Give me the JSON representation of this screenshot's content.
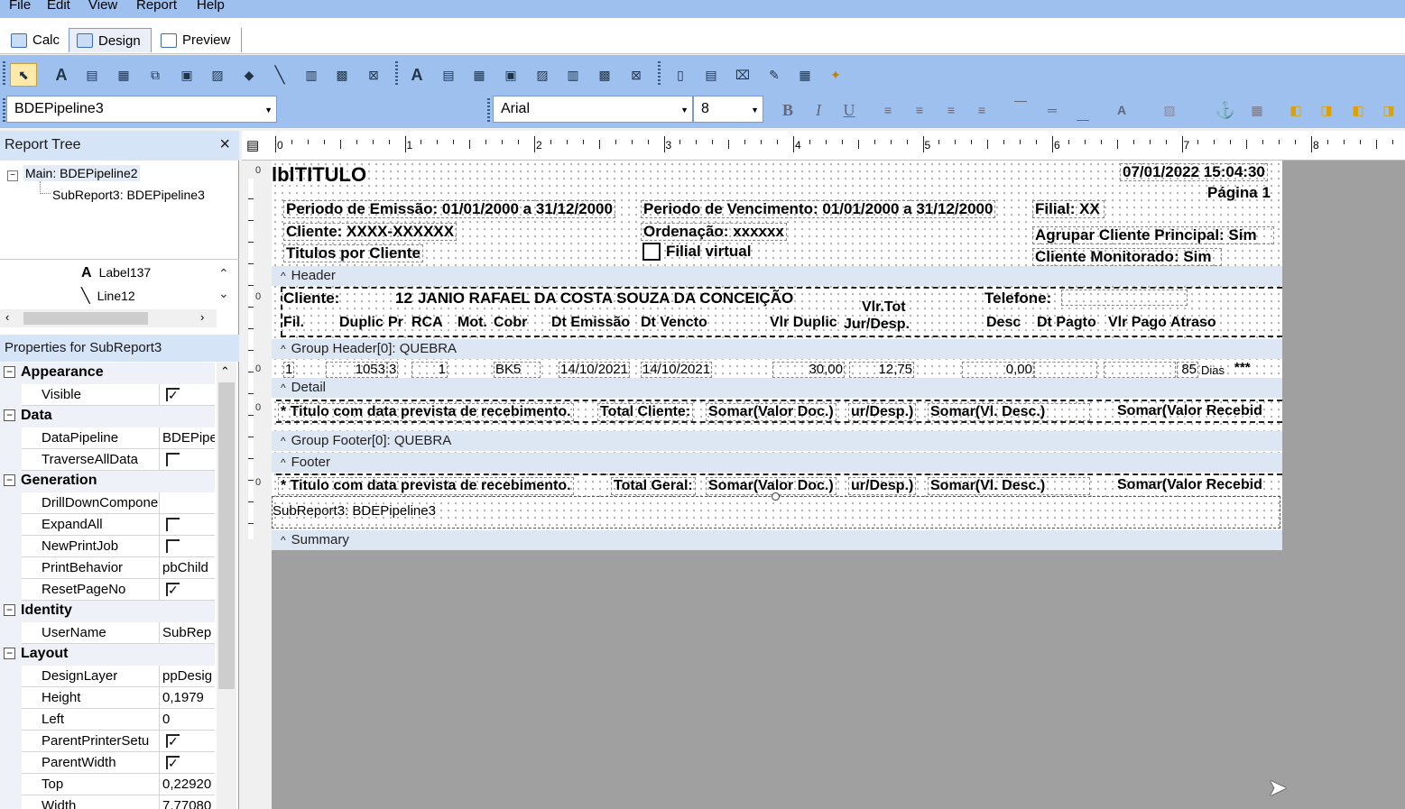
{
  "menu": [
    "File",
    "Edit",
    "View",
    "Report",
    "Help"
  ],
  "tabs": [
    {
      "label": "Calc"
    },
    {
      "label": "Design"
    },
    {
      "label": "Preview"
    }
  ],
  "toolbar": {
    "pipeline_combo": "BDEPipeline3",
    "font_combo": "Arial",
    "size_combo": "8",
    "bold": "B",
    "italic": "I",
    "underline": "U"
  },
  "report_tree": {
    "title": "Report Tree",
    "close": "×",
    "nodes": [
      "Main: BDEPipeline2",
      "SubReport3: BDEPipeline3"
    ],
    "components": [
      "Label137",
      "Line12"
    ]
  },
  "properties": {
    "title": "Properties for SubReport3",
    "categories": [
      {
        "name": "Appearance",
        "rows": [
          {
            "name": "Visible",
            "value": "",
            "checkbox": true,
            "checked": true
          }
        ]
      },
      {
        "name": "Data",
        "rows": [
          {
            "name": "DataPipeline",
            "value": "BDEPipe"
          },
          {
            "name": "TraverseAllData",
            "value": "",
            "checkbox": true,
            "checked": false
          }
        ]
      },
      {
        "name": "Generation",
        "rows": [
          {
            "name": "DrillDownCompone",
            "value": ""
          },
          {
            "name": "ExpandAll",
            "value": "",
            "checkbox": true,
            "checked": false
          },
          {
            "name": "NewPrintJob",
            "value": "",
            "checkbox": true,
            "checked": false
          },
          {
            "name": "PrintBehavior",
            "value": "pbChild"
          },
          {
            "name": "ResetPageNo",
            "value": "",
            "checkbox": true,
            "checked": true
          }
        ]
      },
      {
        "name": "Identity",
        "rows": [
          {
            "name": "UserName",
            "value": "SubRep"
          }
        ]
      },
      {
        "name": "Layout",
        "rows": [
          {
            "name": "DesignLayer",
            "value": "ppDesig"
          },
          {
            "name": "Height",
            "value": "0,1979"
          },
          {
            "name": "Left",
            "value": "0"
          },
          {
            "name": "ParentPrinterSetu",
            "value": "",
            "checkbox": true,
            "checked": true
          },
          {
            "name": "ParentWidth",
            "value": "",
            "checkbox": true,
            "checked": true
          },
          {
            "name": "Top",
            "value": "0,22920"
          },
          {
            "name": "Width",
            "value": "7,77080"
          }
        ]
      }
    ]
  },
  "ruler": [
    "0",
    "1",
    "2",
    "3",
    "4",
    "5",
    "6",
    "7",
    "8"
  ],
  "report": {
    "title_header": {
      "title": "lblTITULO",
      "datetime": "07/01/2022 15:04:30",
      "page": "Página 1",
      "emissao": "Periodo de Emissão: 01/01/2000 a 31/12/2000",
      "vencimento": "Periodo de Vencimento:  01/01/2000 a 31/12/2000",
      "filial": "Filial: XX",
      "cliente": "Cliente: XXXX-XXXXXX",
      "ordenacao": "Ordenação: xxxxxx",
      "titulos": "Titulos por Cliente",
      "filial_virtual": "Filial virtual",
      "agrupar": "Agrupar Cliente Principal: Sim",
      "monitorado": "Cliente Monitorado: Sim"
    },
    "bands": {
      "header": "Header",
      "group_header": "Group Header[0]: QUEBRA",
      "detail": "Detail",
      "group_footer": "Group Footer[0]: QUEBRA",
      "footer": "Footer",
      "summary": "Summary"
    },
    "group_header": {
      "cliente_label": "Cliente:",
      "cliente_code": "12",
      "cliente_name": "JANIO RAFAEL DA COSTA SOUZA DA CONCEIÇÃO",
      "telefone": "Telefone:",
      "cols": [
        "Fil.",
        "Duplic",
        "Pr",
        "RCA",
        "Mot.",
        "Cobr",
        "Dt Emissão",
        "Dt Vencto",
        "Vlr Duplic",
        "Vlr.Tot",
        "Jur/Desp.",
        "Desc",
        "Dt Pagto",
        "Vlr Pago",
        "Atraso"
      ]
    },
    "detail": {
      "fil": "1",
      "duplic": "1053",
      "pr": "3",
      "rca": "1",
      "cobr": "BK5",
      "emissao": "14/10/2021",
      "vencto": "14/10/2021",
      "vlr": "30,00",
      "jur": "12,75",
      "desc": "0,00",
      "atraso": "85",
      "dias": "Dias",
      "stars": "***"
    },
    "group_footer": {
      "nota": "* Titulo com data prevista  de recebimento.",
      "total": "Total Cliente:",
      "sum1": "Somar(Valor Doc.)",
      "sum2": "ur/Desp.)",
      "sum3": "Somar(Vl. Desc.)",
      "sum4": "Somar(Valor Recebid"
    },
    "footer": {
      "nota": "* Titulo com data prevista  de recebimento.",
      "total": "Total Geral:",
      "sum1": "Somar(Valor Doc.)",
      "sum2": "ur/Desp.)",
      "sum3": "Somar(Vl. Desc.)",
      "sum4": "Somar(Valor Recebid",
      "subreport": "SubReport3: BDEPipeline3"
    },
    "band_marker": "0"
  }
}
